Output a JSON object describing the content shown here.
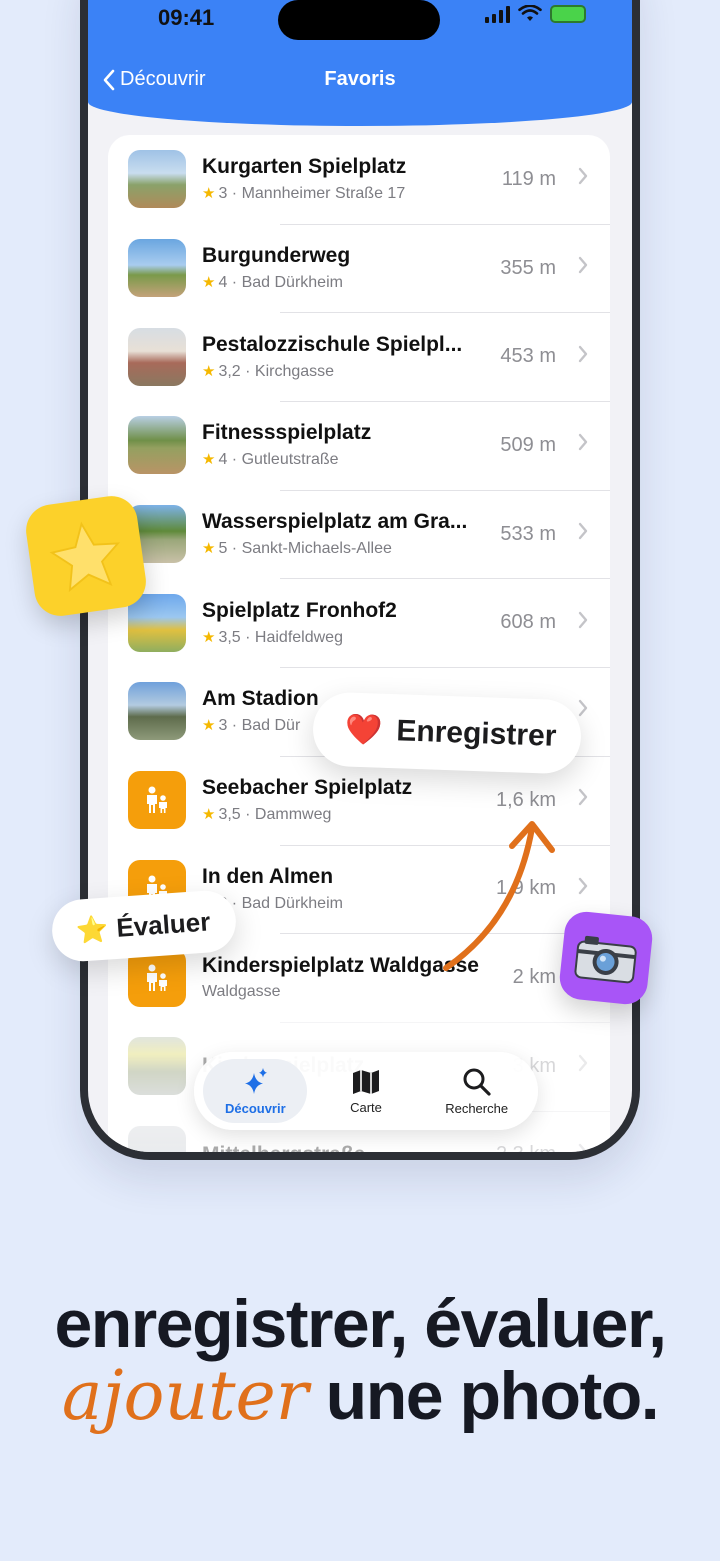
{
  "status_bar": {
    "time": "09:41"
  },
  "nav": {
    "back_label": "Découvrir",
    "title": "Favoris"
  },
  "favorites": [
    {
      "name": "Kurgarten Spielplatz",
      "rating": "3",
      "location": "Mannheimer Straße 17",
      "distance": "119 m",
      "thumb": "photo"
    },
    {
      "name": "Burgunderweg",
      "rating": "4",
      "location": "Bad Dürkheim",
      "distance": "355 m",
      "thumb": "photo"
    },
    {
      "name": "Pestalozzischule Spielpl...",
      "rating": "3,2",
      "location": "Kirchgasse",
      "distance": "453 m",
      "thumb": "photo"
    },
    {
      "name": "Fitnessspielplatz",
      "rating": "4",
      "location": "Gutleutstraße",
      "distance": "509 m",
      "thumb": "photo"
    },
    {
      "name": "Wasserspielplatz am Gra...",
      "rating": "5",
      "location": "Sankt-Michaels-Allee",
      "distance": "533 m",
      "thumb": "photo"
    },
    {
      "name": "Spielplatz Fronhof2",
      "rating": "3,5",
      "location": "Haidfeldweg",
      "distance": "608 m",
      "thumb": "photo"
    },
    {
      "name": "Am Stadion",
      "rating": "3",
      "location": "Bad Dür",
      "distance": "",
      "thumb": "photo"
    },
    {
      "name": "Seebacher Spielplatz",
      "rating": "3,5",
      "location": "Dammweg",
      "distance": "1,6 km",
      "thumb": "placeholder"
    },
    {
      "name": "In den Almen",
      "rating": "3",
      "location": "Bad Dürkheim",
      "distance": "1,9 km",
      "thumb": "placeholder"
    },
    {
      "name": "Kinderspielplatz Waldgasse",
      "rating": "",
      "location": "Waldgasse",
      "distance": "2 km",
      "thumb": "placeholder"
    },
    {
      "name": "Kinderspielplatz",
      "rating": "",
      "location": "",
      "distance": "3 km",
      "thumb": "photo"
    },
    {
      "name": "Mittelbergstraße",
      "rating": "",
      "location": "",
      "distance": "2,3 km",
      "thumb": "photo"
    }
  ],
  "tab_bar": {
    "tabs": [
      {
        "label": "Découvrir",
        "icon": "sparkles-icon",
        "active": true
      },
      {
        "label": "Carte",
        "icon": "map-icon",
        "active": false
      },
      {
        "label": "Recherche",
        "icon": "magnifier-icon",
        "active": false
      }
    ]
  },
  "callouts": {
    "save": {
      "emoji": "❤️",
      "label": "Enregistrer"
    },
    "rate": {
      "emoji": "⭐",
      "label": "Évaluer"
    },
    "star_icon": "star-icon",
    "camera_icon": "camera-icon"
  },
  "headline": {
    "line1": "enregistrer, évaluer,",
    "accent": "ajouter",
    "line2_rest": " une photo."
  },
  "colors": {
    "background": "#e3ebfb",
    "header_blue": "#3b82f6",
    "accent_orange": "#e0701b",
    "star_yellow": "#f5b800",
    "placeholder_orange": "#f59e0b",
    "camera_purple": "#a855f7",
    "active_tab_blue": "#1e6fe6"
  }
}
